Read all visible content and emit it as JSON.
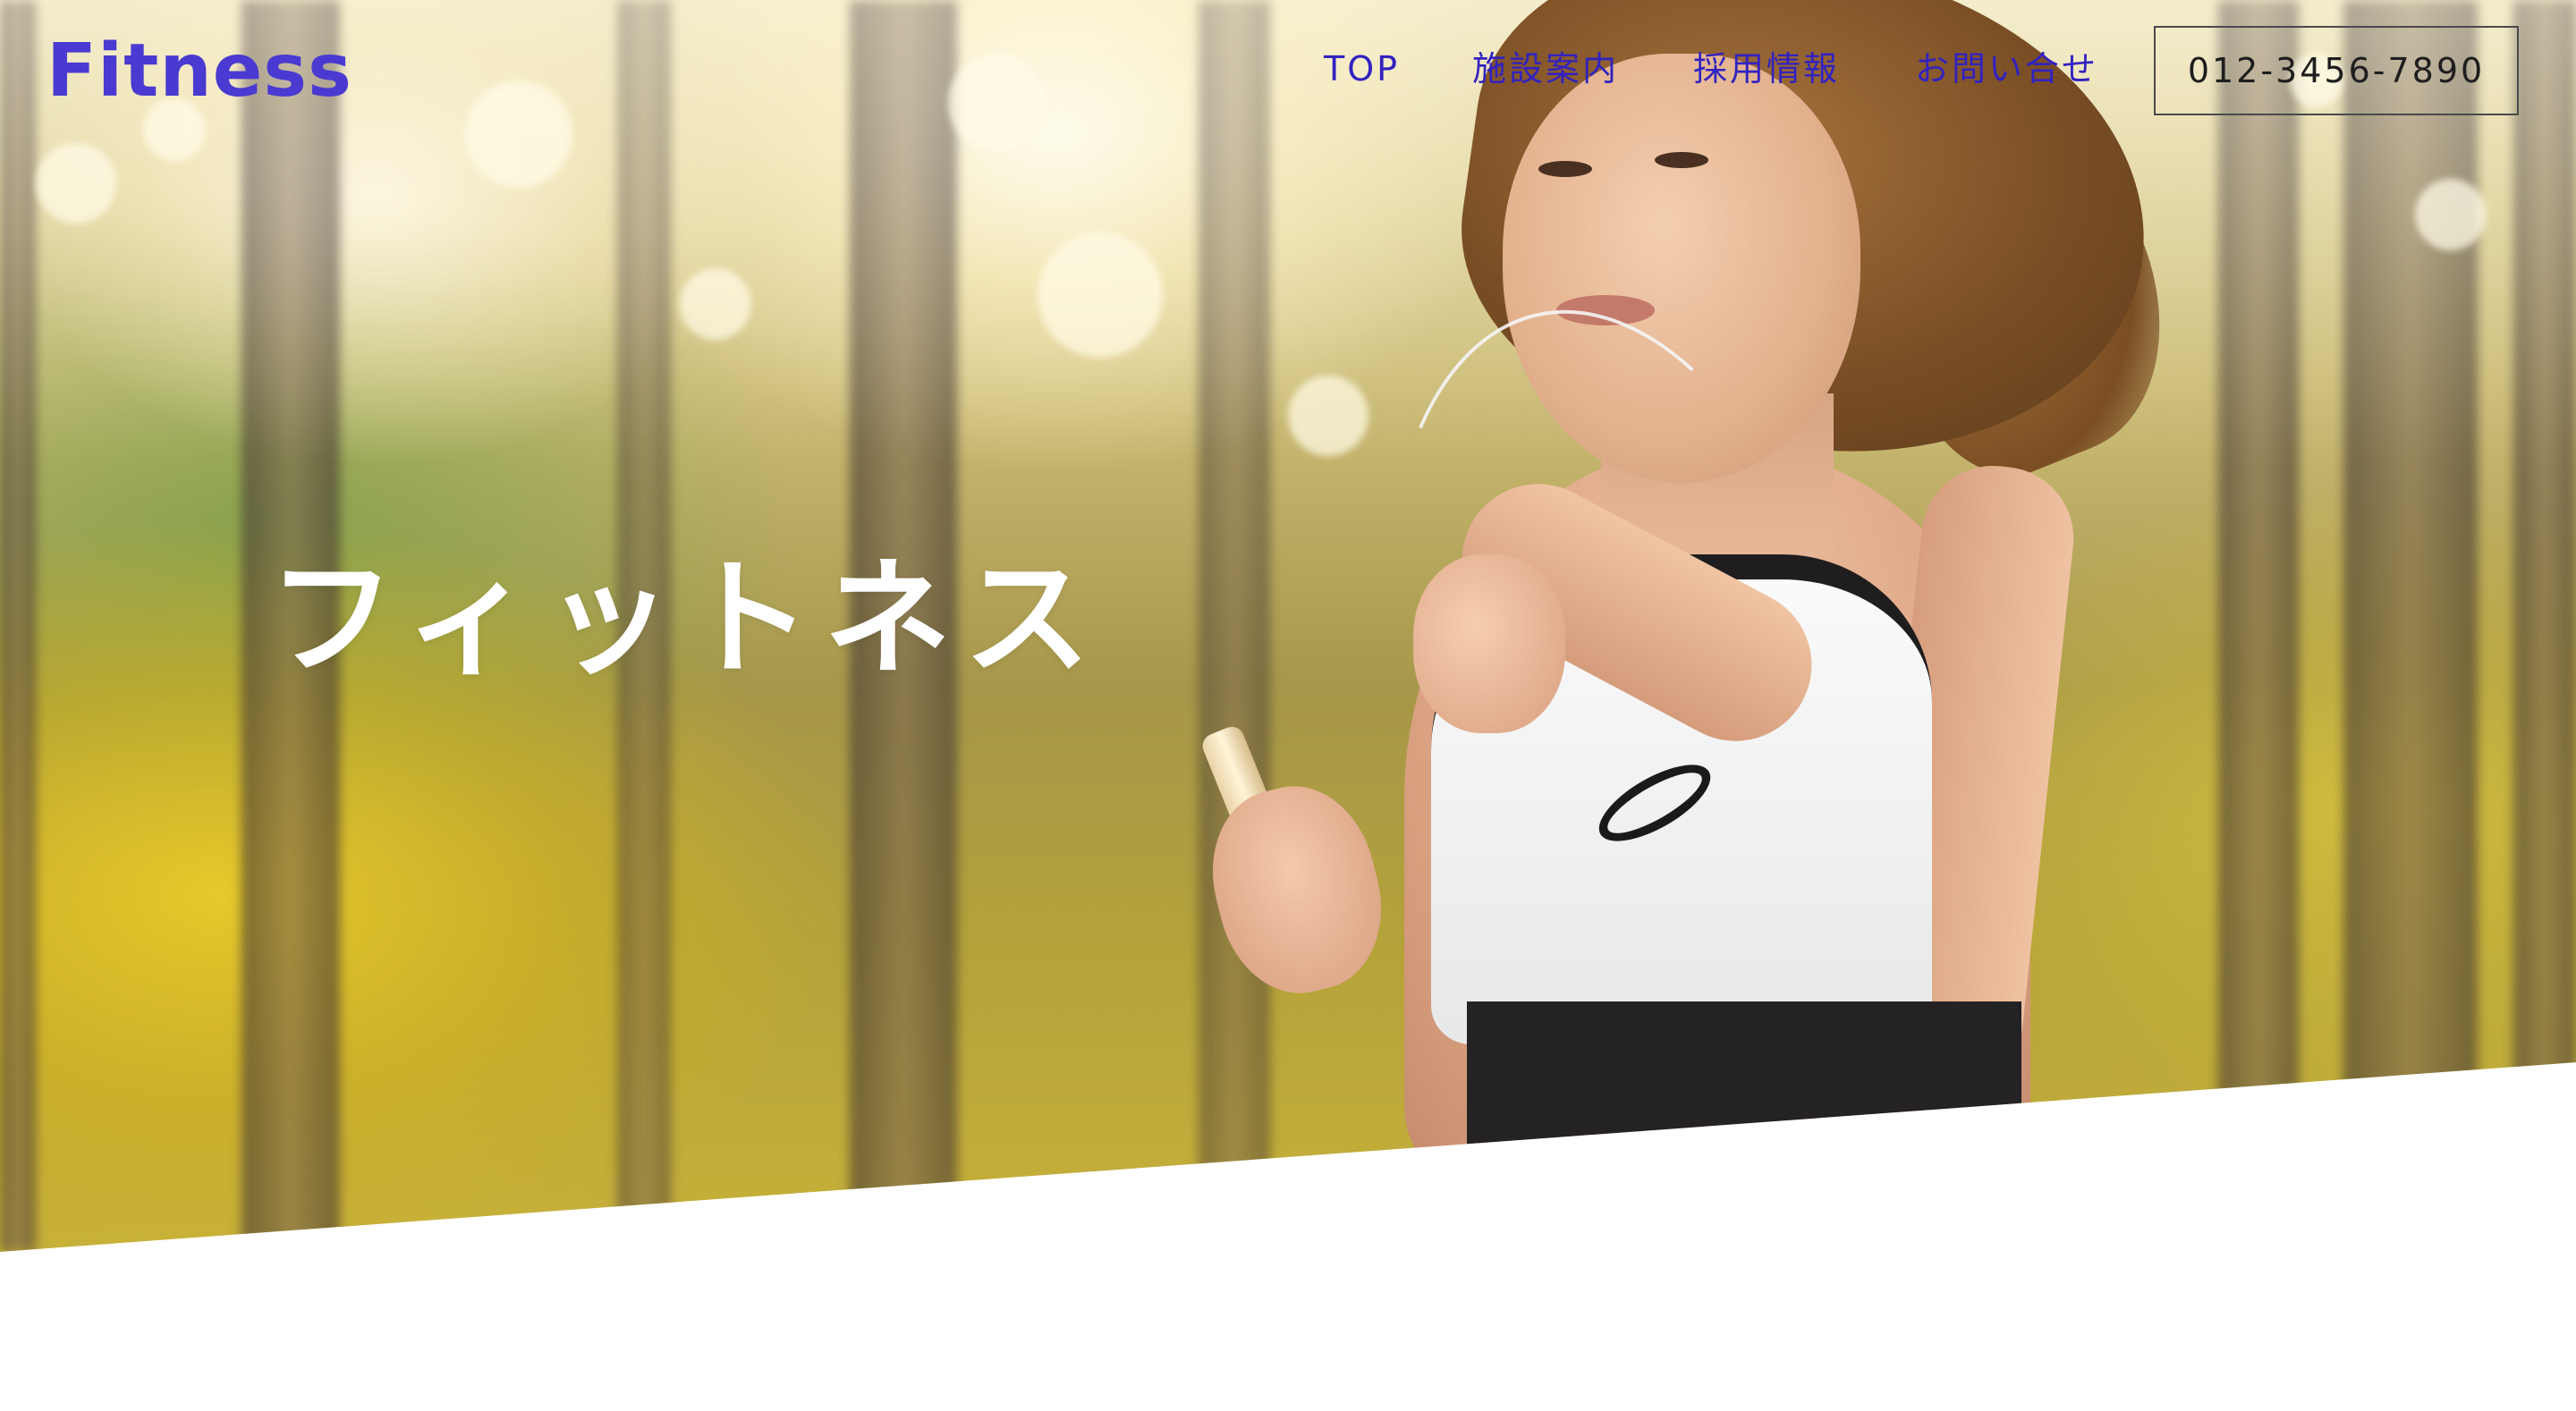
{
  "header": {
    "logo": "Fitness",
    "nav": [
      {
        "label": "TOP"
      },
      {
        "label": "施設案内"
      },
      {
        "label": "採用情報"
      },
      {
        "label": "お問い合せ"
      }
    ],
    "phone": "012-3456-7890"
  },
  "hero": {
    "title": "フィットネス"
  },
  "colors": {
    "logo": "#4a3ad1",
    "nav": "#3222c0",
    "hero_title": "#ffffff",
    "phone_border": "#4a4a4a",
    "background": "#ffffff"
  }
}
